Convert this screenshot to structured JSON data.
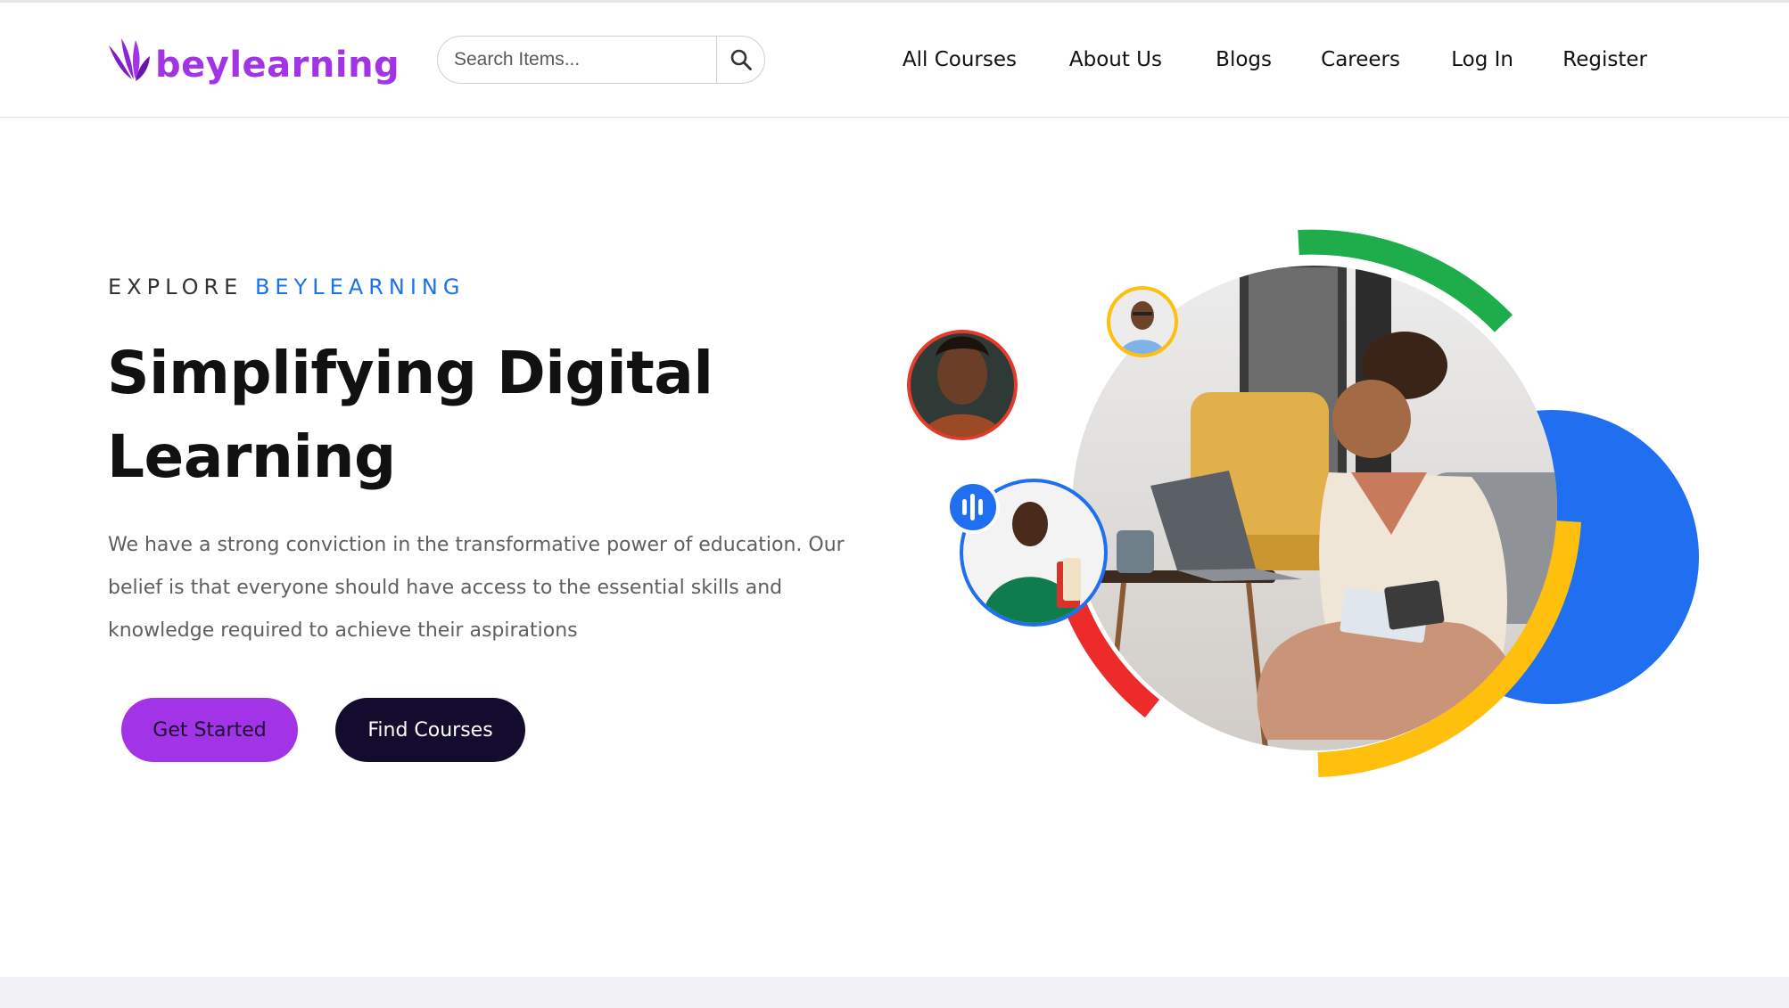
{
  "brand": {
    "name": "beylearning",
    "color": "#a233e6"
  },
  "search": {
    "placeholder": "Search Items...",
    "icon": "search-icon"
  },
  "nav": {
    "items": [
      {
        "label": "All Courses"
      },
      {
        "label": "About Us"
      },
      {
        "label": "Blogs"
      },
      {
        "label": "Careers"
      },
      {
        "label": "Log In"
      },
      {
        "label": "Register"
      }
    ]
  },
  "hero": {
    "eyebrow_prefix": "EXPLORE",
    "eyebrow_accent": "BEYLEARNING",
    "title_line1": "Simplifying Digital",
    "title_line2": "Learning",
    "description": "We have a strong conviction in the transformative power of education. Our belief is that everyone should have access to the essential skills and knowledge required to achieve their aspirations",
    "primary_button": "Get Started",
    "secondary_button": "Find Courses"
  },
  "illustration": {
    "main_photo": "woman studying with laptop and notebook",
    "avatars": [
      "woman-portrait",
      "man-with-glasses-portrait",
      "man-with-books-portrait"
    ],
    "audio_badge_icon": "audio-wave-icon"
  },
  "colors": {
    "accent_blue": "#1a73e8",
    "green": "#1fad4b",
    "red": "#ee2b2b",
    "yellow": "#ffbf0d",
    "blue_disc": "#1f6ff0",
    "dark_button": "#140c2e"
  }
}
